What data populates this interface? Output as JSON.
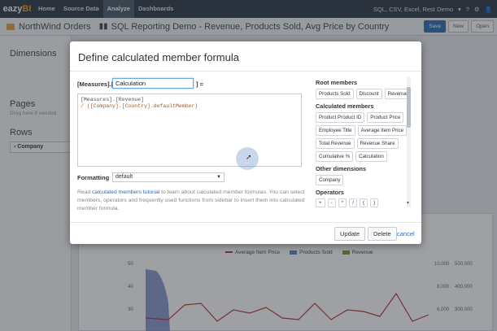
{
  "nav": {
    "logo_main": "eazy",
    "logo_accent": "BI",
    "items": [
      "Home",
      "Source Data",
      "Analyze",
      "Dashboards"
    ],
    "active": "Analyze",
    "right_source": "SQL, CSV, Excel, Rest Demo",
    "help_icon": "question-icon",
    "settings_icon": "gear-icon",
    "user_icon": "user-icon"
  },
  "titlebar": {
    "account": "NorthWind Orders",
    "report": "SQL Reporting Demo - Revenue, Products Sold, Avg Price by Country",
    "save": "Save",
    "new": "New",
    "open": "Open"
  },
  "left": {
    "dimensions": "Dimensions",
    "pages": "Pages",
    "pages_hint": "Drag here if needed",
    "rows": "Rows",
    "row_item": "Company"
  },
  "chart": {
    "legend": [
      {
        "name": "Average Item Price",
        "color": "#b03a3a"
      },
      {
        "name": "Products Sold",
        "color": "#6b7fc2"
      },
      {
        "name": "Revenue",
        "color": "#7a9a3a"
      }
    ],
    "y_ticks": [
      "50",
      "40",
      "30"
    ],
    "y2_ticks": [
      "10,000",
      "8,000",
      "6,000"
    ],
    "y3_ticks": [
      "500,000",
      "400,000",
      "300,000"
    ]
  },
  "modal": {
    "title": "Define calculated member formula",
    "prefix": "[Measures].[",
    "name_value": "Calculation",
    "suffix": "] =",
    "formula_line1": "[Measures].[Revenue]",
    "formula_line2": "/ ([Company].[Country].defaultMember)",
    "formatting_label": "Formatting",
    "formatting_value": "default",
    "help_pre": "Read ",
    "help_link": "calculated members tutorial",
    "help_post": " to learn about calculated member formulas. You can select members, operators and frequently used functions from sidebar to insert them into calculated member formula.",
    "update": "Update",
    "delete": "Delete",
    "cancel": "cancel"
  },
  "sidebar": {
    "root_header": "Root members",
    "root_members": [
      "Products Sold",
      "Discount",
      "Revenue"
    ],
    "calc_header": "Calculated members",
    "calc_members": [
      "Product Product ID",
      "Product Price",
      "Employee Title",
      "Average Item Price",
      "Total Revenue",
      "Revenue Share",
      "Cumulative %",
      "Calculation"
    ],
    "other_header": "Other dimensions",
    "other_members": [
      "Company"
    ],
    "ops_header": "Operators",
    "ops_row1": [
      "+",
      "-",
      "*",
      "/",
      "(",
      ")"
    ],
    "ops_row2": [
      "and",
      "or",
      "not",
      "<",
      "<=",
      ">"
    ]
  }
}
